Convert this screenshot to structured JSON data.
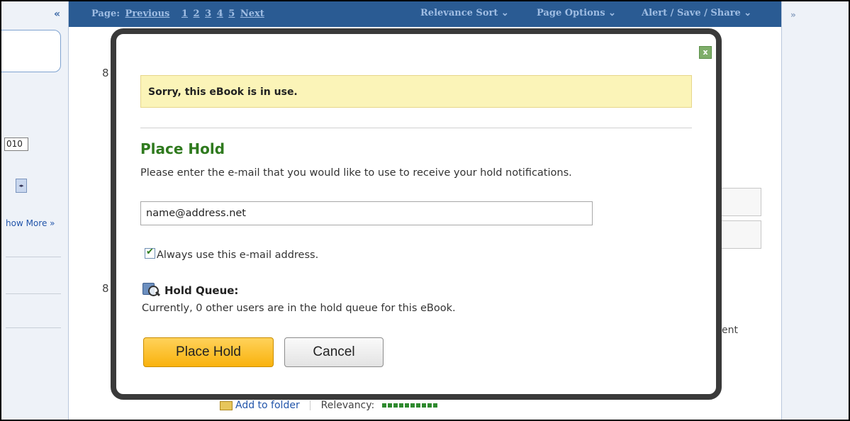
{
  "pager": {
    "label": "Page:",
    "previous": "Previous",
    "pages": [
      "1",
      "2",
      "3",
      "4",
      "5"
    ],
    "next": "Next"
  },
  "toolbar": {
    "relevance_sort": "Relevance Sort ⌄",
    "page_options": "Page Options ⌄",
    "alert_save_share": "Alert / Save / Share ⌄"
  },
  "sidebar": {
    "collapse": "«",
    "year_value": "010",
    "show_more": "how More »",
    "expand": "»"
  },
  "results": {
    "num_1": "8",
    "num_2": "8",
    "fragment": "ent",
    "add_to_folder": "Add to folder",
    "relevancy_label": "Relevancy:",
    "relevancy_level": 1.0
  },
  "modal": {
    "close": "x",
    "alert_text": "Sorry, this eBook is in use.",
    "heading": "Place Hold",
    "instructions": "Please enter the e-mail that you would like to use to receive your hold notifications.",
    "email_value": "name@address.net",
    "always_use_label": "Always use this e-mail address.",
    "always_use_checked": true,
    "queue_title": "Hold Queue:",
    "queue_text": "Currently, 0 other users are in the hold queue for this eBook.",
    "place_hold_button": "Place Hold",
    "cancel_button": "Cancel"
  },
  "colors": {
    "toolbar_bg": "#2a5b93",
    "toolbar_text": "#9fbde3",
    "alert_bg": "#fbf4b8",
    "heading_green": "#2f7a1e",
    "primary_button": "#f9b20d",
    "modal_border": "#3a3a3a"
  }
}
